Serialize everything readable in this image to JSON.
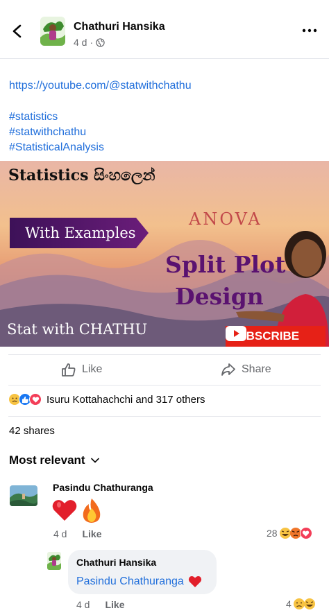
{
  "header": {
    "author": "Chathuri Hansika",
    "time": "4 d",
    "privacy_icon": "globe-icon",
    "back_icon": "chevron-left-icon",
    "more_icon": "more-horizontal-icon"
  },
  "post": {
    "link": "https://youtube.com/@statwithchathu",
    "hashtags": [
      "#statistics",
      "#statwithchathu",
      "#StatisticalAnalysis"
    ]
  },
  "thumbnail": {
    "title": "Statistics සිංහලෙන්",
    "subscribe_label": "SUBSCRIBE",
    "subtitle": "ANOVA",
    "examples_label": "With Examples",
    "line1": "Split Plot",
    "line2": "Design",
    "brand": "Stat with CHATHU"
  },
  "actions": {
    "like_label": "Like",
    "share_label": "Share"
  },
  "reactions": {
    "text": "Isuru Kottahachchi and 317 others",
    "icons": [
      "sad-emoji-icon",
      "like-icon",
      "love-icon"
    ]
  },
  "shares": "42 shares",
  "sort": {
    "label": "Most relevant"
  },
  "comments": [
    {
      "author": "Pasindu Chathuranga",
      "emojis": [
        "red-heart-emoji",
        "fire-emoji"
      ],
      "time": "4 d",
      "like_label": "Like",
      "reaction_count": "28",
      "reaction_icons": [
        "laugh-emoji-icon",
        "angry-emoji-icon",
        "love-icon"
      ]
    }
  ],
  "reply": {
    "author": "Chathuri Hansika",
    "mention": "Pasindu Chathuranga",
    "emoji": "red-heart-emoji",
    "time": "4 d",
    "like_label": "Like",
    "reaction_count": "4",
    "reaction_icons": [
      "sad-emoji-icon",
      "laugh-emoji-icon"
    ]
  },
  "colors": {
    "link": "#216fdb",
    "secondary_text": "#65676b",
    "like_blue": "#1877f2",
    "love_red": "#f33e58",
    "subscribe_red": "#e62117"
  }
}
